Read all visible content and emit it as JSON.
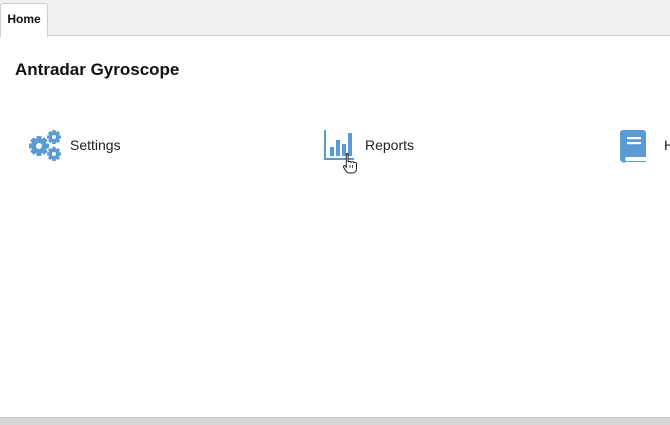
{
  "tabs": [
    {
      "label": "Home",
      "active": true
    }
  ],
  "app": {
    "title": "Antradar Gyroscope"
  },
  "launchers": [
    {
      "label": "Settings",
      "icon": "gears-icon"
    },
    {
      "label": "Reports",
      "icon": "bar-chart-icon"
    },
    {
      "label": "He",
      "icon": "book-icon"
    }
  ],
  "colors": {
    "icon_blue": "#5b9bd5",
    "tabbar_bg": "#f1f1f1",
    "text": "#222222"
  }
}
